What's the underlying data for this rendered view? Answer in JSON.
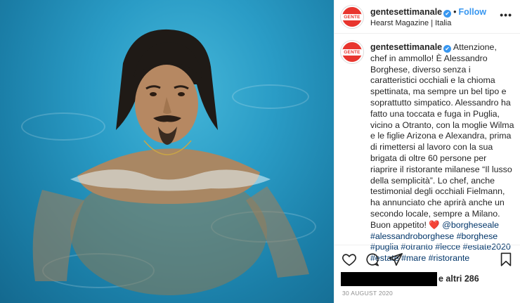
{
  "post": {
    "account": {
      "username": "gentesettimanale",
      "verified_glyph": "✔",
      "separator": "•",
      "follow_label": "Follow",
      "location": "Hearst Magazine | Italia",
      "avatar_text": "GENTE"
    },
    "more_icon": "•••",
    "caption": {
      "username": "gentesettimanale",
      "text_main": "Attenzione, chef in ammollo! È Alessandro Borghese, diverso senza i caratteristici occhiali e la chioma spettinata, ma sempre un bel tipo e soprattutto simpatico. Alessandro ha fatto una toccata e fuga in Puglia, vicino a Otranto, con la moglie Wilma e le figlie Arizona e Alexandra, prima di rimettersi al lavoro con la sua brigata di oltre 60 persone per riaprire il ristorante milanese “Il lusso della semplicità”. Lo chef, anche testimonial degli occhiali Fielmann, ha annunciato che aprirà anche un secondo locale, sempre a Milano. Buon appetito!",
      "heart_emoji": "❤️",
      "mention": "@borgheseale",
      "hashtags": "#alessandroborghese #borghese #puglia #otranto #lecce #estate2020 #estate #mare #ristorante"
    },
    "actions": {
      "like_icon": "heart-outline-icon",
      "comment_icon": "comment-bubble-icon",
      "share_icon": "paper-plane-icon",
      "save_icon": "bookmark-icon"
    },
    "likes_text": "e altri 286",
    "date": "30 AUGUST 2020",
    "colors": {
      "brand_red": "#e8352e",
      "link_blue": "#3897f0",
      "hashtag_blue": "#003569",
      "water": "#2a9cc6"
    }
  }
}
